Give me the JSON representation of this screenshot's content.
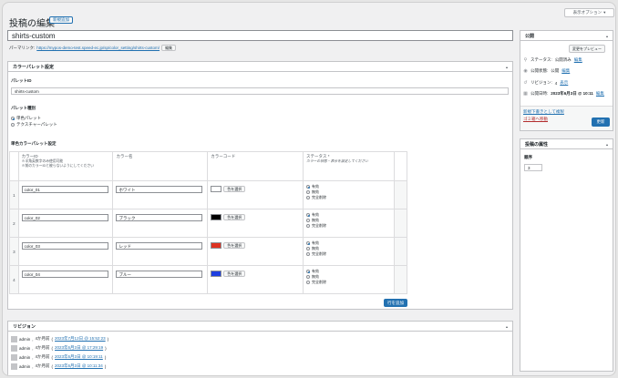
{
  "header": {
    "screen_options": "表示オプション",
    "page_title": "投稿の編集",
    "add_new": "新規追加"
  },
  "post": {
    "title": "shirts-custom",
    "permalink_label": "パーマリンク:",
    "permalink_url": "https://mypos-demo-test.speed-ec.jp/sp/color_setting/shirts-custom/",
    "edit_button": "編集"
  },
  "palette_box": {
    "title": "カラーパレット設定",
    "id_label": "パレットID",
    "id_value": "shirts-custom",
    "type_label": "パレット種別",
    "type_options": [
      "単色パレット",
      "テクスチャーパレット"
    ],
    "single_label": "単色カラーパレット設定",
    "headers": {
      "color_id": "カラーID",
      "color_id_note": "※半角英数字のみ使用可能\n※前のカラーIDと被らないようにしてください",
      "color_name": "カラー名",
      "color_code": "カラーコード",
      "status": "ステータス *",
      "status_note": "カラーの状態・表示を設定してください"
    },
    "select_color_label": "色を選択",
    "status_options": [
      "有効",
      "無効",
      "完全削除"
    ],
    "rows": [
      {
        "num": "1",
        "id": "color_01",
        "name": "ホワイト",
        "swatch": "#ffffff"
      },
      {
        "num": "2",
        "id": "color_02",
        "name": "ブラック",
        "swatch": "#000000"
      },
      {
        "num": "3",
        "id": "color_03",
        "name": "レッド",
        "swatch": "#dd3322"
      },
      {
        "num": "4",
        "id": "color_04",
        "name": "ブルー",
        "swatch": "#1e3fe0"
      }
    ],
    "add_row": "行を追加"
  },
  "revisions_box": {
    "title": "リビジョン",
    "items": [
      {
        "author": "admin",
        "ago": "4か月前",
        "date": "2023年7月12日 @ 15:52:23"
      },
      {
        "author": "admin",
        "ago": "4か月前",
        "date": "2023年6月3日 @ 17:29:19"
      },
      {
        "author": "admin",
        "ago": "4か月前",
        "date": "2023年6月3日 @ 10:19:11"
      },
      {
        "author": "admin",
        "ago": "4か月前",
        "date": "2023年6月3日 @ 10:11:34"
      }
    ]
  },
  "publish_box": {
    "title": "公開",
    "preview": "変更をプレビュー",
    "status_label": "ステータス:",
    "status_value": "公開済み",
    "visibility_label": "公開状態:",
    "visibility_value": "公開",
    "revisions_label": "リビジョン:",
    "revisions_count": "4",
    "revisions_link": "表示",
    "published_label": "公開日時:",
    "published_value": "2023年6月3日 @ 10:11",
    "edit_link": "編集",
    "copy_link": "新規下書きとして複製",
    "trash_link": "ゴミ箱へ移動",
    "update_button": "更新"
  },
  "attributes_box": {
    "title": "投稿の属性",
    "order_label": "順序",
    "order_value": "3"
  }
}
